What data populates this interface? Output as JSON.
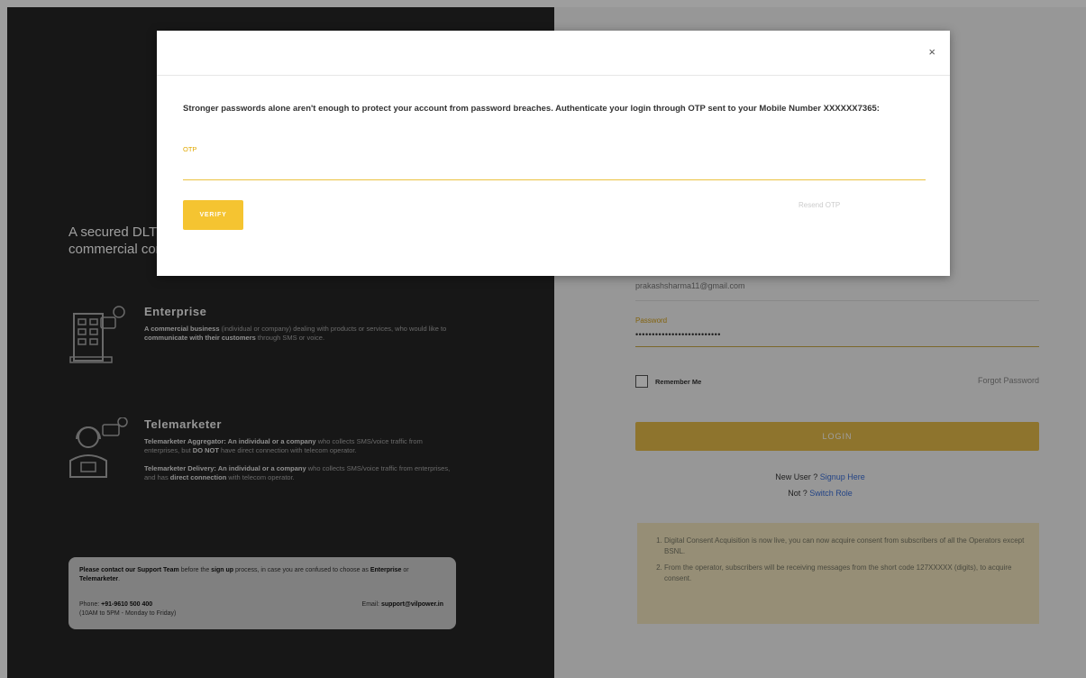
{
  "left_panel": {
    "tagline": "A secured DLT platform for commercial communication",
    "enterprise": {
      "title": "Enterprise",
      "description_bold_1": "A commercial business",
      "description_text_1": " (individual or company) dealing with products or services, who would like to ",
      "description_bold_2": "communicate with their customers",
      "description_text_2": " through SMS or voice."
    },
    "telemarketer": {
      "title": "Telemarketer",
      "aggregator_bold_1": "Telemarketer Aggregator: An individual or a company",
      "aggregator_text_1": " who collects SMS/voice traffic from enterprises, but ",
      "aggregator_bold_2": "DO NOT",
      "aggregator_text_2": " have direct connection with telecom operator.",
      "delivery_bold_1": "Telemarketer Delivery: An individual or a company",
      "delivery_text_1": " who collects SMS/voice traffic from enterprises, and has ",
      "delivery_bold_2": "direct connection",
      "delivery_text_2": " with telecom operator."
    },
    "support": {
      "prefix": "Please contact our ",
      "team_bold": "Support Team",
      "mid_text": " before the ",
      "signup_bold": "sign up",
      "suffix": " process, in case you are confused to choose as ",
      "enterprise_bold": "Enterprise",
      "or_text": " or ",
      "telemarketer_bold": "Telemarketer",
      "end": ".",
      "phone_label": "Phone: ",
      "phone": "+91-9610 500 400",
      "hours": "(10AM to 5PM - Monday to Friday)",
      "email_label": "Email: ",
      "email": "support@vilpower.in"
    }
  },
  "login_form": {
    "email_value": "prakashsharma11@gmail.com",
    "password_label": "Password",
    "password_value": "••••••••••••••••••••••••••",
    "remember_label": "Remember Me",
    "forgot_label": "Forgot Password",
    "login_label": "LOGIN",
    "new_user_text": "New User ? ",
    "new_user_link": "Signup Here",
    "not_text": "Not ? ",
    "not_link": "Switch Role",
    "notices": [
      "Digital Consent Acquisition is now live, you can now acquire consent from subscribers of all the Operators except BSNL.",
      "From the operator, subscribers will be receiving messages from the short code 127XXXXX (digits), to acquire consent."
    ]
  },
  "modal": {
    "close_label": "×",
    "message": "Stronger passwords alone aren't enough to protect your account from password breaches. Authenticate your login through OTP sent to your Mobile Number XXXXXX7365:",
    "otp_label": "OTP",
    "otp_value": "",
    "verify_label": "VERIFY",
    "resend_label": "Resend OTP"
  },
  "colors": {
    "accent": "#f5c431",
    "left_bg": "#262626",
    "link": "#3a6fd8"
  }
}
